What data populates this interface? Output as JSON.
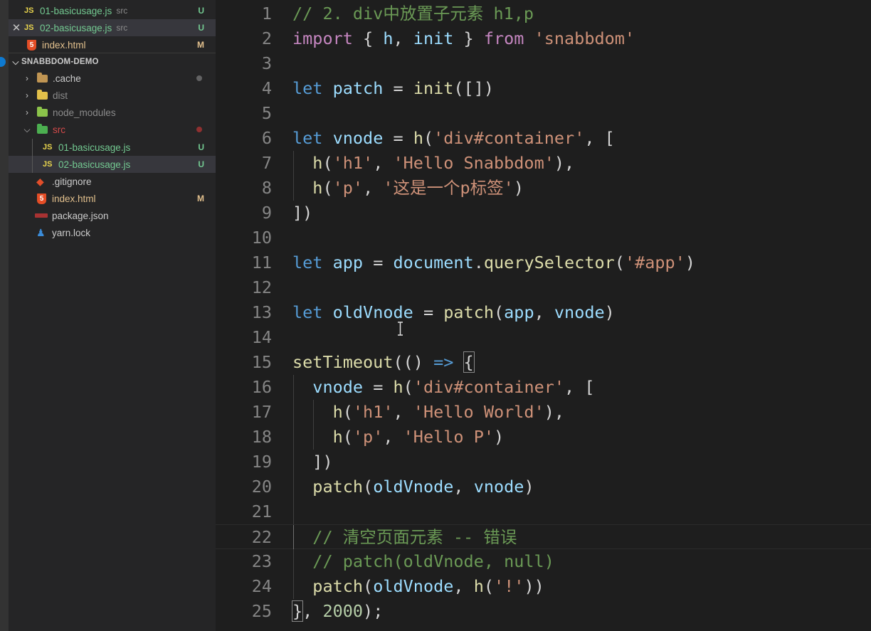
{
  "sidebar": {
    "open_editors": [
      {
        "name": "01-basicusage.js",
        "dir": "src",
        "badge": "U",
        "icon": "js-icon"
      },
      {
        "name": "02-basicusage.js",
        "dir": "src",
        "badge": "U",
        "icon": "js-icon"
      },
      {
        "name": "index.html",
        "badge": "M",
        "icon": "html-icon"
      }
    ],
    "project_title": "SNABBDOM-DEMO",
    "tree": [
      {
        "name": ".cache",
        "icon": "folder-icon"
      },
      {
        "name": "dist",
        "icon": "folder-icon"
      },
      {
        "name": "node_modules",
        "icon": "folder-icon"
      },
      {
        "name": "src",
        "icon": "folder-icon"
      },
      {
        "name": "01-basicusage.js",
        "badge": "U",
        "icon": "js-icon"
      },
      {
        "name": "02-basicusage.js",
        "badge": "U",
        "icon": "js-icon"
      },
      {
        "name": ".gitignore",
        "icon": "git-icon"
      },
      {
        "name": "index.html",
        "badge": "M",
        "icon": "html-icon"
      },
      {
        "name": "package.json",
        "icon": "npm-icon"
      },
      {
        "name": "yarn.lock",
        "icon": "yarn-icon"
      }
    ]
  },
  "editor": {
    "line_numbers": [
      "1",
      "2",
      "3",
      "4",
      "5",
      "6",
      "7",
      "8",
      "9",
      "10",
      "11",
      "12",
      "13",
      "14",
      "15",
      "16",
      "17",
      "18",
      "19",
      "20",
      "21",
      "22",
      "23",
      "24",
      "25"
    ],
    "lines": [
      [
        [
          "cm",
          "// 2. div中放置子元素 h1,p"
        ]
      ],
      [
        [
          "imp",
          "import"
        ],
        [
          "p",
          " { "
        ],
        [
          "var",
          "h"
        ],
        [
          "p",
          ", "
        ],
        [
          "var",
          "init"
        ],
        [
          "p",
          " } "
        ],
        [
          "imp",
          "from"
        ],
        [
          "p",
          " "
        ],
        [
          "str",
          "'snabbdom'"
        ]
      ],
      [],
      [
        [
          "kw",
          "let"
        ],
        [
          "p",
          " "
        ],
        [
          "var",
          "patch"
        ],
        [
          "p",
          " = "
        ],
        [
          "fn",
          "init"
        ],
        [
          "p",
          "([])"
        ]
      ],
      [],
      [
        [
          "kw",
          "let"
        ],
        [
          "p",
          " "
        ],
        [
          "var",
          "vnode"
        ],
        [
          "p",
          " = "
        ],
        [
          "fn",
          "h"
        ],
        [
          "p",
          "("
        ],
        [
          "str",
          "'div#container'"
        ],
        [
          "p",
          ", ["
        ]
      ],
      [
        [
          "p",
          "  "
        ],
        [
          "fn",
          "h"
        ],
        [
          "p",
          "("
        ],
        [
          "str",
          "'h1'"
        ],
        [
          "p",
          ", "
        ],
        [
          "str",
          "'Hello Snabbdom'"
        ],
        [
          "p",
          "),"
        ]
      ],
      [
        [
          "p",
          "  "
        ],
        [
          "fn",
          "h"
        ],
        [
          "p",
          "("
        ],
        [
          "str",
          "'p'"
        ],
        [
          "p",
          ", "
        ],
        [
          "str",
          "'这是一个p标签'"
        ],
        [
          "p",
          ")"
        ]
      ],
      [
        [
          "p",
          "])"
        ]
      ],
      [],
      [
        [
          "kw",
          "let"
        ],
        [
          "p",
          " "
        ],
        [
          "var",
          "app"
        ],
        [
          "p",
          " = "
        ],
        [
          "var",
          "document"
        ],
        [
          "p",
          "."
        ],
        [
          "fn",
          "querySelector"
        ],
        [
          "p",
          "("
        ],
        [
          "str",
          "'#app'"
        ],
        [
          "p",
          ")"
        ]
      ],
      [],
      [
        [
          "kw",
          "let"
        ],
        [
          "p",
          " "
        ],
        [
          "var",
          "oldVnode"
        ],
        [
          "p",
          " = "
        ],
        [
          "fn",
          "patch"
        ],
        [
          "p",
          "("
        ],
        [
          "var",
          "app"
        ],
        [
          "p",
          ", "
        ],
        [
          "var",
          "vnode"
        ],
        [
          "p",
          ")"
        ]
      ],
      [],
      [
        [
          "fn",
          "setTimeout"
        ],
        [
          "p",
          "(() "
        ],
        [
          "kw",
          "=>"
        ],
        [
          "p",
          " "
        ],
        [
          "box",
          "{"
        ]
      ],
      [
        [
          "p",
          "  "
        ],
        [
          "var",
          "vnode"
        ],
        [
          "p",
          " = "
        ],
        [
          "fn",
          "h"
        ],
        [
          "p",
          "("
        ],
        [
          "str",
          "'div#container'"
        ],
        [
          "p",
          ", ["
        ]
      ],
      [
        [
          "p",
          "    "
        ],
        [
          "fn",
          "h"
        ],
        [
          "p",
          "("
        ],
        [
          "str",
          "'h1'"
        ],
        [
          "p",
          ", "
        ],
        [
          "str",
          "'Hello World'"
        ],
        [
          "p",
          "),"
        ]
      ],
      [
        [
          "p",
          "    "
        ],
        [
          "fn",
          "h"
        ],
        [
          "p",
          "("
        ],
        [
          "str",
          "'p'"
        ],
        [
          "p",
          ", "
        ],
        [
          "str",
          "'Hello P'"
        ],
        [
          "p",
          ")"
        ]
      ],
      [
        [
          "p",
          "  ])"
        ]
      ],
      [
        [
          "p",
          "  "
        ],
        [
          "fn",
          "patch"
        ],
        [
          "p",
          "("
        ],
        [
          "var",
          "oldVnode"
        ],
        [
          "p",
          ", "
        ],
        [
          "var",
          "vnode"
        ],
        [
          "p",
          ")"
        ]
      ],
      [],
      [
        [
          "p",
          "  "
        ],
        [
          "cm",
          "// 清空页面元素 -- 错误"
        ]
      ],
      [
        [
          "p",
          "  "
        ],
        [
          "cm",
          "// patch(oldVnode, null)"
        ]
      ],
      [
        [
          "p",
          "  "
        ],
        [
          "fn",
          "patch"
        ],
        [
          "p",
          "("
        ],
        [
          "var",
          "oldVnode"
        ],
        [
          "p",
          ", "
        ],
        [
          "fn",
          "h"
        ],
        [
          "p",
          "("
        ],
        [
          "str",
          "'!'"
        ],
        [
          "p",
          "))"
        ]
      ],
      [
        [
          "box",
          "}"
        ],
        [
          "p",
          ", "
        ],
        [
          "num",
          "2000"
        ],
        [
          "p",
          ");"
        ]
      ]
    ]
  },
  "colors": {
    "keyword": "#569cd6",
    "import": "#c586c0",
    "variable": "#9cdcfe",
    "function": "#dcdcaa",
    "string": "#ce9178",
    "comment": "#6a9955",
    "number": "#b5cea8"
  }
}
